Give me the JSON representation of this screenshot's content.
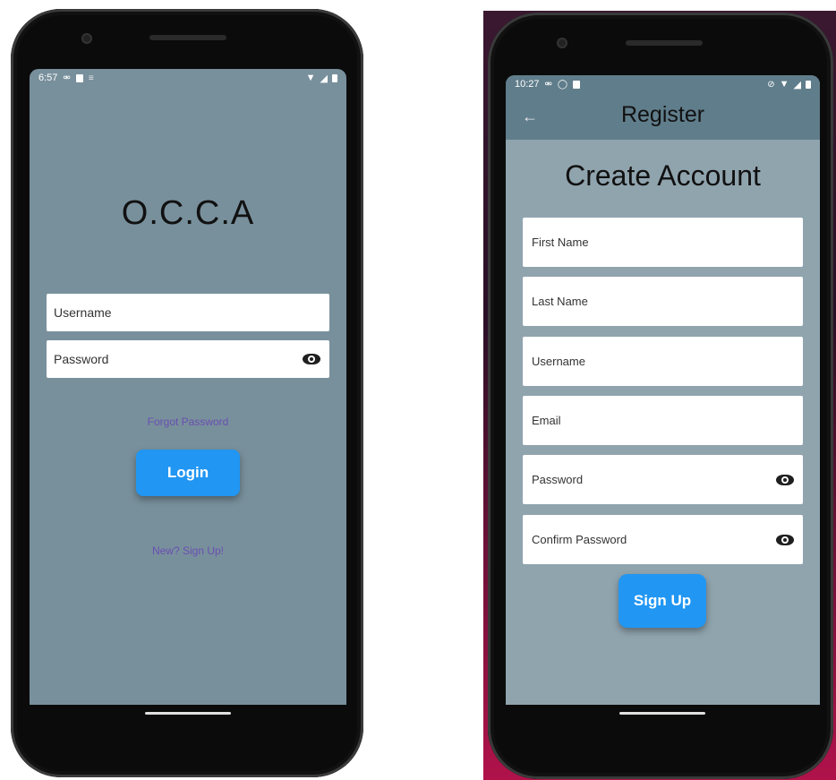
{
  "login_screen": {
    "status_time": "6:57",
    "app_title": "O.C.C.A",
    "username_placeholder": "Username",
    "password_placeholder": "Password",
    "forgot_password_link": "Forgot Password",
    "login_button": "Login",
    "signup_link": "New? Sign Up!"
  },
  "register_screen": {
    "status_time": "10:27",
    "appbar_title": "Register",
    "heading": "Create Account",
    "fields": {
      "first_name": "First Name",
      "last_name": "Last Name",
      "username": "Username",
      "email": "Email",
      "password": "Password",
      "confirm_password": "Confirm Password"
    },
    "signup_button": "Sign Up"
  },
  "icons": {
    "back": "arrow-left-icon",
    "password_toggle": "eye-icon"
  },
  "colors": {
    "login_background": "#78909c",
    "register_background": "#90a4ae",
    "appbar": "#607d8b",
    "button": "#2196f3",
    "link": "#6a4fb0"
  }
}
